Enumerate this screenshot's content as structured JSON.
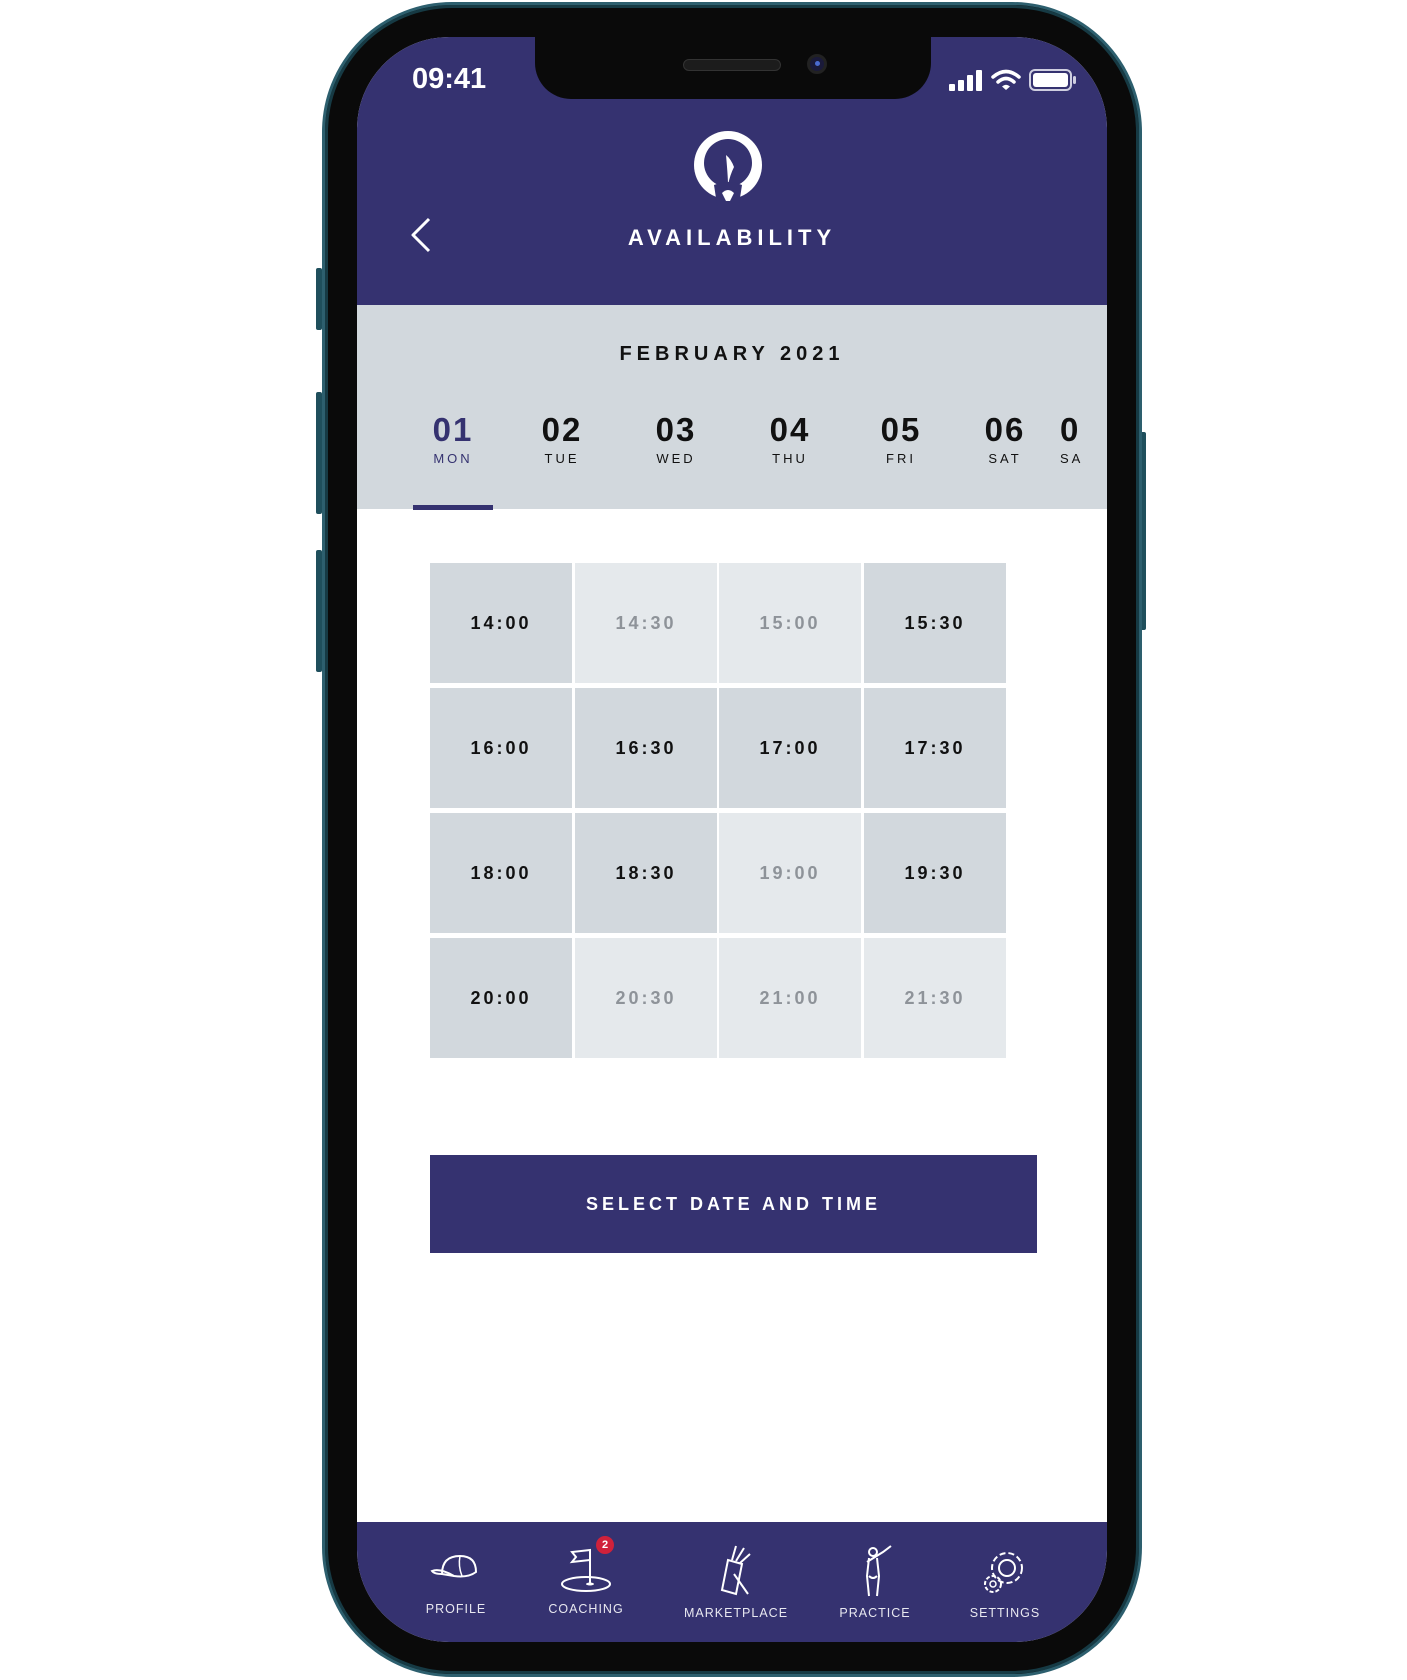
{
  "status_bar": {
    "time": "09:41"
  },
  "header": {
    "title": "AVAILABILITY",
    "back_icon": "chevron-left-icon"
  },
  "calendar": {
    "month": "FEBRUARY 2021",
    "days": [
      {
        "num": "01",
        "weekday": "MON",
        "active": true
      },
      {
        "num": "02",
        "weekday": "TUE"
      },
      {
        "num": "03",
        "weekday": "WED"
      },
      {
        "num": "04",
        "weekday": "THU"
      },
      {
        "num": "05",
        "weekday": "FRI"
      },
      {
        "num": "06",
        "weekday": "SAT"
      },
      {
        "num": "0",
        "weekday": "SA"
      }
    ]
  },
  "slots": [
    {
      "time": "14:00",
      "available": true
    },
    {
      "time": "14:30",
      "available": false
    },
    {
      "time": "15:00",
      "available": false
    },
    {
      "time": "15:30",
      "available": true
    },
    {
      "time": "16:00",
      "available": true
    },
    {
      "time": "16:30",
      "available": true
    },
    {
      "time": "17:00",
      "available": true
    },
    {
      "time": "17:30",
      "available": true
    },
    {
      "time": "18:00",
      "available": true
    },
    {
      "time": "18:30",
      "available": true
    },
    {
      "time": "19:00",
      "available": false
    },
    {
      "time": "19:30",
      "available": true
    },
    {
      "time": "20:00",
      "available": true
    },
    {
      "time": "20:30",
      "available": false
    },
    {
      "time": "21:00",
      "available": false
    },
    {
      "time": "21:30",
      "available": false
    }
  ],
  "cta": {
    "label": "SELECT DATE AND TIME"
  },
  "tabbar": {
    "items": [
      {
        "label": "PROFILE",
        "icon": "cap-icon"
      },
      {
        "label": "COACHING",
        "icon": "golf-flag-icon",
        "badge": "2"
      },
      {
        "label": "MARKETPLACE",
        "icon": "golf-bag-icon"
      },
      {
        "label": "PRACTICE",
        "icon": "golfer-icon"
      },
      {
        "label": "SETTINGS",
        "icon": "gear-icon"
      }
    ]
  },
  "colors": {
    "brand": "#353270",
    "slot_available": "#d2d8dd",
    "slot_unavailable": "#e5e9ec",
    "badge": "#d0213a"
  }
}
